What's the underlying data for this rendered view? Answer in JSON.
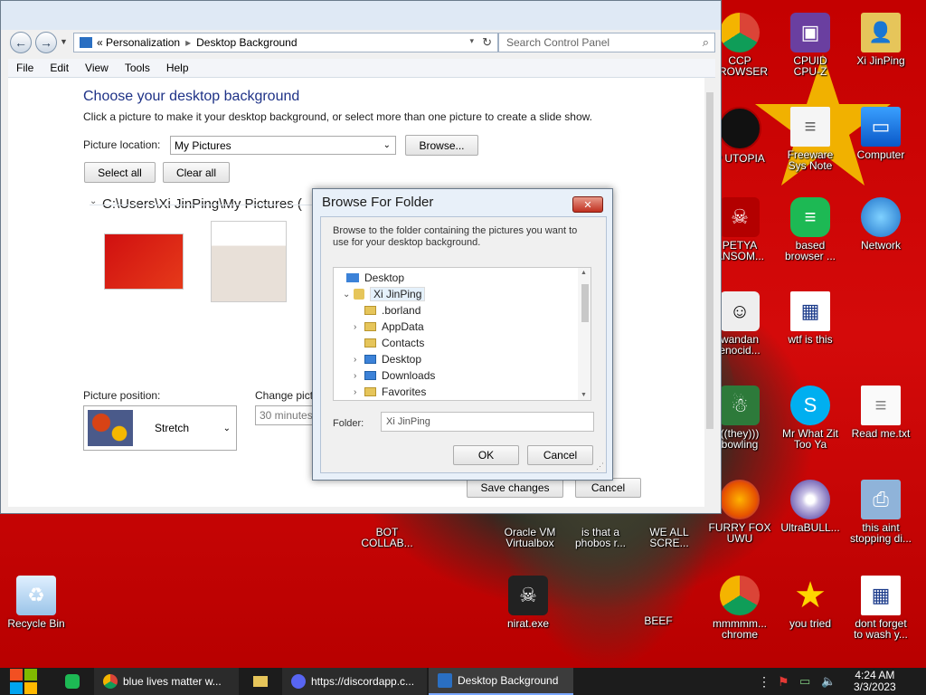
{
  "window": {
    "breadcrumb_prefix": "«",
    "breadcrumb_1": "Personalization",
    "breadcrumb_2": "Desktop Background",
    "search_placeholder": "Search Control Panel",
    "menu": [
      "File",
      "Edit",
      "View",
      "Tools",
      "Help"
    ],
    "heading": "Choose your desktop background",
    "subheading": "Click a picture to make it your desktop background, or select more than one picture to create a slide show.",
    "picture_location_label": "Picture location:",
    "picture_location_value": "My Pictures",
    "browse_label": "Browse...",
    "select_all_label": "Select all",
    "clear_all_label": "Clear all",
    "folder_path": "C:\\Users\\Xi JinPing\\My Pictures (",
    "picture_position_label": "Picture position:",
    "picture_position_value": "Stretch",
    "change_picture_label": "Change pict",
    "change_picture_value": "30 minutes",
    "save_label": "Save changes",
    "cancel_label": "Cancel"
  },
  "dialog": {
    "title": "Browse For Folder",
    "close_label": "✕",
    "instructions": "Browse to the folder containing the pictures you want to use for your desktop background.",
    "tree": [
      {
        "label": "Desktop",
        "level": 0,
        "expanded": false,
        "selected": false
      },
      {
        "label": "Xi JinPing",
        "level": 1,
        "expanded": true,
        "selected": true
      },
      {
        "label": ".borland",
        "level": 2,
        "expanded": false,
        "selected": false
      },
      {
        "label": "AppData",
        "level": 2,
        "expanded": false,
        "selected": false
      },
      {
        "label": "Contacts",
        "level": 2,
        "expanded": false,
        "selected": false
      },
      {
        "label": "Desktop",
        "level": 2,
        "expanded": false,
        "selected": false
      },
      {
        "label": "Downloads",
        "level": 2,
        "expanded": false,
        "selected": false
      },
      {
        "label": "Favorites",
        "level": 2,
        "expanded": false,
        "selected": false
      }
    ],
    "folder_label": "Folder:",
    "folder_value": "Xi JinPing",
    "ok_label": "OK",
    "cancel_label": "Cancel"
  },
  "desktop_icons": [
    {
      "label": "CCP\nBROWSER",
      "icon": "chrome-icon"
    },
    {
      "label": "CPUID\nCPU-Z",
      "icon": "cpuz-icon"
    },
    {
      "label": "Xi JinPing",
      "icon": "user-folder-icon"
    },
    {
      "label": "P UTOPIA",
      "icon": "utopia-icon"
    },
    {
      "label": "Freeware\nSys Note",
      "icon": "document-icon"
    },
    {
      "label": "Computer",
      "icon": "computer-icon"
    },
    {
      "label": "PETYA\nANSOM...",
      "icon": "skull-icon"
    },
    {
      "label": "based\nbrowser ...",
      "icon": "browser-icon"
    },
    {
      "label": "Network",
      "icon": "network-icon"
    },
    {
      "label": "wandan\nenocid...",
      "icon": "meme-icon"
    },
    {
      "label": "wtf is this",
      "icon": "calendar-icon"
    },
    {
      "label": "((they)))\nbowling",
      "icon": "santa-icon"
    },
    {
      "label": "Mr What Zit\nToo Ya",
      "icon": "skype-icon"
    },
    {
      "label": "Read me.txt",
      "icon": "text-file-icon"
    },
    {
      "label": "BOT\nCOLLAB...",
      "icon": "bot-icon"
    },
    {
      "label": "Oracle VM\nVirtualbox",
      "icon": "virtualbox-icon"
    },
    {
      "label": "is that a\nphobos r...",
      "icon": "phobos-icon"
    },
    {
      "label": "WE ALL\nSCRE...",
      "icon": "scream-icon"
    },
    {
      "label": "FURRY FOX\nUWU",
      "icon": "firefox-icon"
    },
    {
      "label": "UltraBULL...",
      "icon": "disc-icon"
    },
    {
      "label": "this aint\nstopping di...",
      "icon": "installer-icon"
    },
    {
      "label": "Recycle Bin",
      "icon": "recycle-bin-icon"
    },
    {
      "label": "nirat.exe",
      "icon": "skull-exe-icon"
    },
    {
      "label": "BEEF",
      "icon": "vlc-icon"
    },
    {
      "label": "mmmmm...\nchrome",
      "icon": "chrome-icon"
    },
    {
      "label": "you tried",
      "icon": "star-icon"
    },
    {
      "label": "dont forget\nto wash y...",
      "icon": "calendar-icon"
    }
  ],
  "taskbar": {
    "items": [
      {
        "label": "blue lives matter w...",
        "icon": "chrome-icon"
      },
      {
        "label": "https://discordapp.c...",
        "icon": "discord-icon"
      },
      {
        "label": "Desktop Background",
        "icon": "control-panel-icon"
      }
    ],
    "time": "4:24 AM",
    "date": "3/3/2023"
  },
  "colors": {
    "wallpaper_red": "#c40000",
    "heading_blue": "#1e3287",
    "taskbar": "#1c1c1c"
  }
}
